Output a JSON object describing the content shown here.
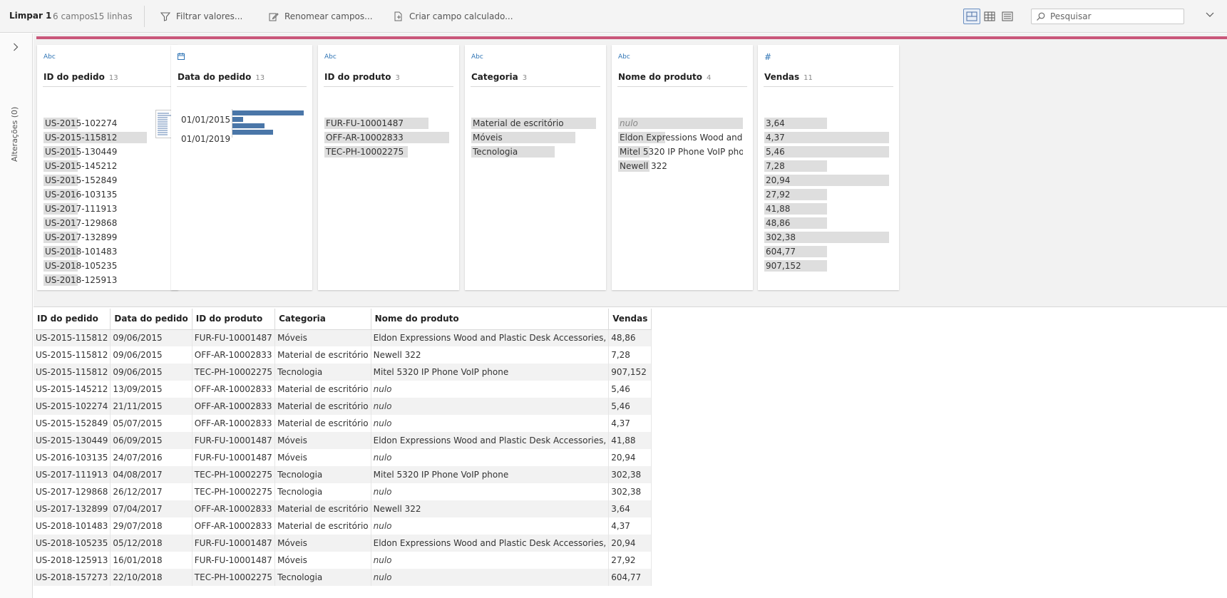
{
  "toolbar": {
    "title": "Limpar 1",
    "fields_count": "6 campos",
    "rows_count": "15 linhas",
    "filter_label": "Filtrar valores...",
    "rename_label": "Renomear campos...",
    "calc_label": "Criar campo calculado...",
    "search_placeholder": "Pesquisar"
  },
  "rail": {
    "label": "Alterações (0)"
  },
  "profile": {
    "cards": [
      {
        "type": "Abc",
        "title": "ID do pedido",
        "count": "13",
        "values": [
          "US-2015-102274",
          "US-2015-115812",
          "US-2015-130449",
          "US-2015-145212",
          "US-2015-152849",
          "US-2016-103135",
          "US-2017-111913",
          "US-2017-129868",
          "US-2017-132899",
          "US-2018-101483",
          "US-2018-105235",
          "US-2018-125913"
        ],
        "freq": [
          1,
          3,
          1,
          1,
          1,
          1,
          1,
          1,
          1,
          1,
          1,
          1
        ]
      },
      {
        "type": "date",
        "title": "Data do pedido",
        "count": "13",
        "ticks": [
          "01/01/2015",
          "01/01/2019"
        ],
        "bins": [
          4,
          0.6,
          1.8,
          2.3
        ]
      },
      {
        "type": "Abc",
        "title": "ID do produto",
        "count": "3",
        "values": [
          "FUR-FU-10001487",
          "OFF-AR-10002833",
          "TEC-PH-10002275"
        ],
        "freq": [
          5,
          6,
          4
        ]
      },
      {
        "type": "Abc",
        "title": "Categoria",
        "count": "3",
        "values": [
          "Material de escritório",
          "Móveis",
          "Tecnologia"
        ],
        "freq": [
          6,
          5,
          4
        ]
      },
      {
        "type": "Abc",
        "title": "Nome do produto",
        "count": "4",
        "values": [
          "nulo",
          "Eldon Expressions Wood and Plastic Desk Accessories,",
          "Mitel 5320 IP Phone VoIP phone",
          "Newell 322"
        ],
        "freq": [
          8,
          3,
          2,
          2
        ]
      },
      {
        "type": "#",
        "title": "Vendas",
        "count": "11",
        "values": [
          "3,64",
          "4,37",
          "5,46",
          "7,28",
          "20,94",
          "27,92",
          "41,88",
          "48,86",
          "302,38",
          "604,77",
          "907,152"
        ],
        "freq": [
          1,
          2,
          2,
          1,
          2,
          1,
          1,
          1,
          2,
          1,
          1
        ]
      }
    ]
  },
  "grid": {
    "columns": [
      "ID do pedido",
      "Data do pedido",
      "ID do produto",
      "Categoria",
      "Nome do produto",
      "Vendas"
    ],
    "rows": [
      [
        "US-2015-115812",
        "09/06/2015",
        "FUR-FU-10001487",
        "Móveis",
        "Eldon Expressions Wood and Plastic Desk Accessories,",
        "48,86"
      ],
      [
        "US-2015-115812",
        "09/06/2015",
        "OFF-AR-10002833",
        "Material de escritório",
        "Newell 322",
        "7,28"
      ],
      [
        "US-2015-115812",
        "09/06/2015",
        "TEC-PH-10002275",
        "Tecnologia",
        "Mitel 5320 IP Phone VoIP phone",
        "907,152"
      ],
      [
        "US-2015-145212",
        "13/09/2015",
        "OFF-AR-10002833",
        "Material de escritório",
        "nulo",
        "5,46"
      ],
      [
        "US-2015-102274",
        "21/11/2015",
        "OFF-AR-10002833",
        "Material de escritório",
        "nulo",
        "5,46"
      ],
      [
        "US-2015-152849",
        "05/07/2015",
        "OFF-AR-10002833",
        "Material de escritório",
        "nulo",
        "4,37"
      ],
      [
        "US-2015-130449",
        "06/09/2015",
        "FUR-FU-10001487",
        "Móveis",
        "Eldon Expressions Wood and Plastic Desk Accessories,",
        "41,88"
      ],
      [
        "US-2016-103135",
        "24/07/2016",
        "FUR-FU-10001487",
        "Móveis",
        "nulo",
        "20,94"
      ],
      [
        "US-2017-111913",
        "04/08/2017",
        "TEC-PH-10002275",
        "Tecnologia",
        "Mitel 5320 IP Phone VoIP phone",
        "302,38"
      ],
      [
        "US-2017-129868",
        "26/12/2017",
        "TEC-PH-10002275",
        "Tecnologia",
        "nulo",
        "302,38"
      ],
      [
        "US-2017-132899",
        "07/04/2017",
        "OFF-AR-10002833",
        "Material de escritório",
        "Newell 322",
        "3,64"
      ],
      [
        "US-2018-101483",
        "29/07/2018",
        "OFF-AR-10002833",
        "Material de escritório",
        "nulo",
        "4,37"
      ],
      [
        "US-2018-105235",
        "05/12/2018",
        "FUR-FU-10001487",
        "Móveis",
        "Eldon Expressions Wood and Plastic Desk Accessories,",
        "20,94"
      ],
      [
        "US-2018-125913",
        "16/01/2018",
        "FUR-FU-10001487",
        "Móveis",
        "nulo",
        "27,92"
      ],
      [
        "US-2018-157273",
        "22/10/2018",
        "TEC-PH-10002275",
        "Tecnologia",
        "nulo",
        "604,77"
      ]
    ],
    "null_token": "nulo"
  },
  "colors": {
    "accent_bar": "#c9577a",
    "type_icon": "#2f74b5",
    "hist_bar": "#4a76a8",
    "freq_bar": "#dedede"
  }
}
